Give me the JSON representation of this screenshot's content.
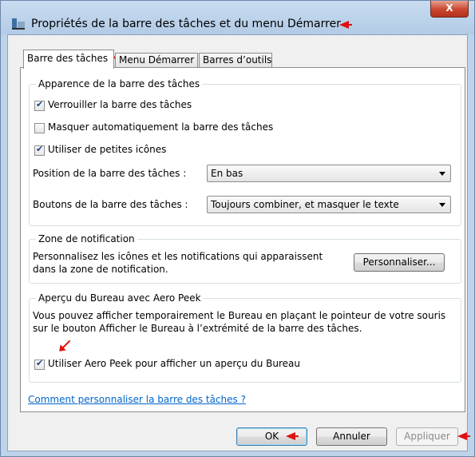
{
  "window": {
    "title": "Propriétés de la barre des tâches et du menu Démarrer",
    "close_label": "X"
  },
  "tabs": [
    {
      "label": "Barre des tâches",
      "active": true
    },
    {
      "label": "Menu Démarrer",
      "active": false
    },
    {
      "label": "Barres d’outils",
      "active": false
    }
  ],
  "appearance": {
    "title": "Apparence de la barre des tâches",
    "lock_label": "Verrouiller la barre des tâches",
    "lock_checked": true,
    "autohide_label": "Masquer automatiquement la barre des tâches",
    "autohide_checked": false,
    "small_icons_label": "Utiliser de petites icônes",
    "small_icons_checked": true,
    "position_label": "Position de la barre des tâches :",
    "position_value": "En bas",
    "buttons_label": "Boutons de la barre des tâches :",
    "buttons_value": "Toujours combiner, et masquer le texte"
  },
  "notification": {
    "title": "Zone de notification",
    "text_line1": "Personnalisez les icônes et les notifications qui apparaissent",
    "text_line2": "dans la zone de notification.",
    "customize_button": "Personnaliser..."
  },
  "aero_peek": {
    "title": "Aperçu du Bureau avec Aero Peek",
    "text_line1": "Vous pouvez afficher temporairement le Bureau en plaçant le pointeur de votre souris",
    "text_line2": "sur le bouton Afficher le Bureau à l’extrémité de la barre des tâches.",
    "checkbox_label": "Utiliser Aero Peek pour afficher un aperçu du Bureau",
    "checked": true
  },
  "help_link": "Comment personnaliser la barre des tâches ?",
  "footer": {
    "ok": "OK",
    "cancel": "Annuler",
    "apply": "Appliquer"
  },
  "colors": {
    "annotation_arrow": "#e01010",
    "link": "#0066cc",
    "title_bar": "#bcd3ea"
  }
}
